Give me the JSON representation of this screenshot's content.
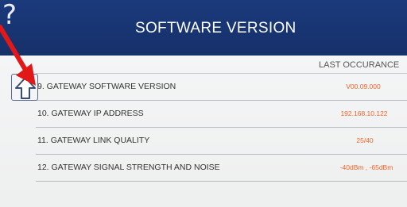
{
  "header": {
    "title": "SOFTWARE VERSION",
    "help_icon_glyph": "?"
  },
  "table": {
    "column_header": "LAST OCCURANCE",
    "rows": [
      {
        "label": "9.  GATEWAY SOFTWARE VERSION",
        "value": "V00.09.000"
      },
      {
        "label": "10. GATEWAY IP ADDRESS",
        "value": "192.168.10.122"
      },
      {
        "label": "11. GATEWAY LINK QUALITY",
        "value": "25/40"
      },
      {
        "label": "12. GATEWAY SIGNAL STRENGTH AND NOISE",
        "value": "-40dBm , -65dBm"
      }
    ]
  },
  "icons": {
    "help": "question-mark-icon",
    "scroll_up": "up-arrow-icon",
    "pointer": "red-pointer-arrow"
  },
  "colors": {
    "header_bg": "#1b3a7c",
    "value_text": "#f0642a",
    "pointer_arrow": "#e21818"
  }
}
